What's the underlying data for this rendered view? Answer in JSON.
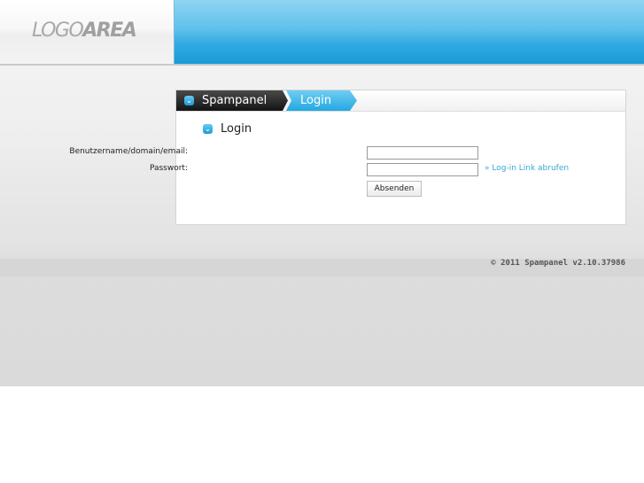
{
  "header": {
    "logo_light": "LOGO",
    "logo_bold": "AREA"
  },
  "breadcrumb": {
    "home": "Spampanel",
    "current": "Login"
  },
  "section": {
    "title": "Login",
    "icon": "chevron-down-icon"
  },
  "form": {
    "username_label": "Benutzername/domain/email:",
    "username_value": "",
    "password_label": "Passwort:",
    "password_value": "",
    "forgot_link": "» Log-in Link abrufen",
    "submit_label": "Absenden"
  },
  "footer": {
    "copyright": "© 2011 Spampanel v2.10.37986"
  },
  "colors": {
    "accent_blue": "#2fa9e0",
    "link_blue": "#38a7d8",
    "dark_crumb": "#141414"
  }
}
